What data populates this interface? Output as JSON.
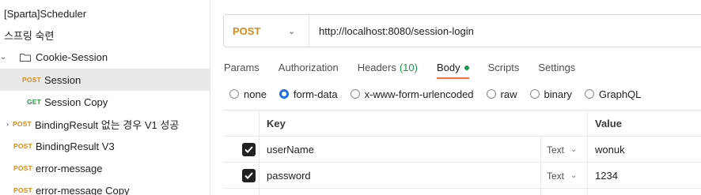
{
  "sidebar": {
    "collection": "[Sparta]Scheduler",
    "folder": "스프링 숙련",
    "subfolder": "Cookie-Session",
    "items": [
      {
        "method": "POST",
        "name": "Session",
        "selected": true
      },
      {
        "method": "GET",
        "name": "Session Copy",
        "selected": false
      },
      {
        "method": "POST",
        "name": "BindingResult 없는 경우 V1 성공",
        "selected": false
      },
      {
        "method": "POST",
        "name": "BindingResult V3",
        "selected": false
      },
      {
        "method": "POST",
        "name": "error-message",
        "selected": false
      },
      {
        "method": "POST",
        "name": "error-message Copy",
        "selected": false
      }
    ]
  },
  "request": {
    "method": "POST",
    "url": "http://localhost:8080/session-login"
  },
  "tabs": {
    "params": "Params",
    "authorization": "Authorization",
    "headers": "Headers",
    "headers_count": "(10)",
    "body": "Body",
    "scripts": "Scripts",
    "settings": "Settings"
  },
  "body_types": {
    "none": "none",
    "form_data": "form-data",
    "urlencoded": "x-www-form-urlencoded",
    "raw": "raw",
    "binary": "binary",
    "graphql": "GraphQL",
    "selected": "form-data"
  },
  "table": {
    "key_header": "Key",
    "value_header": "Value",
    "rows": [
      {
        "key": "userName",
        "type": "Text",
        "value": "wonuk",
        "checked": true
      },
      {
        "key": "password",
        "type": "Text",
        "value": "1234",
        "checked": true
      }
    ]
  },
  "colors": {
    "post": "#d98a1a",
    "get": "#1a9a4a",
    "active_tab": "#ff6c37",
    "radio_on": "#1f6fe5"
  }
}
